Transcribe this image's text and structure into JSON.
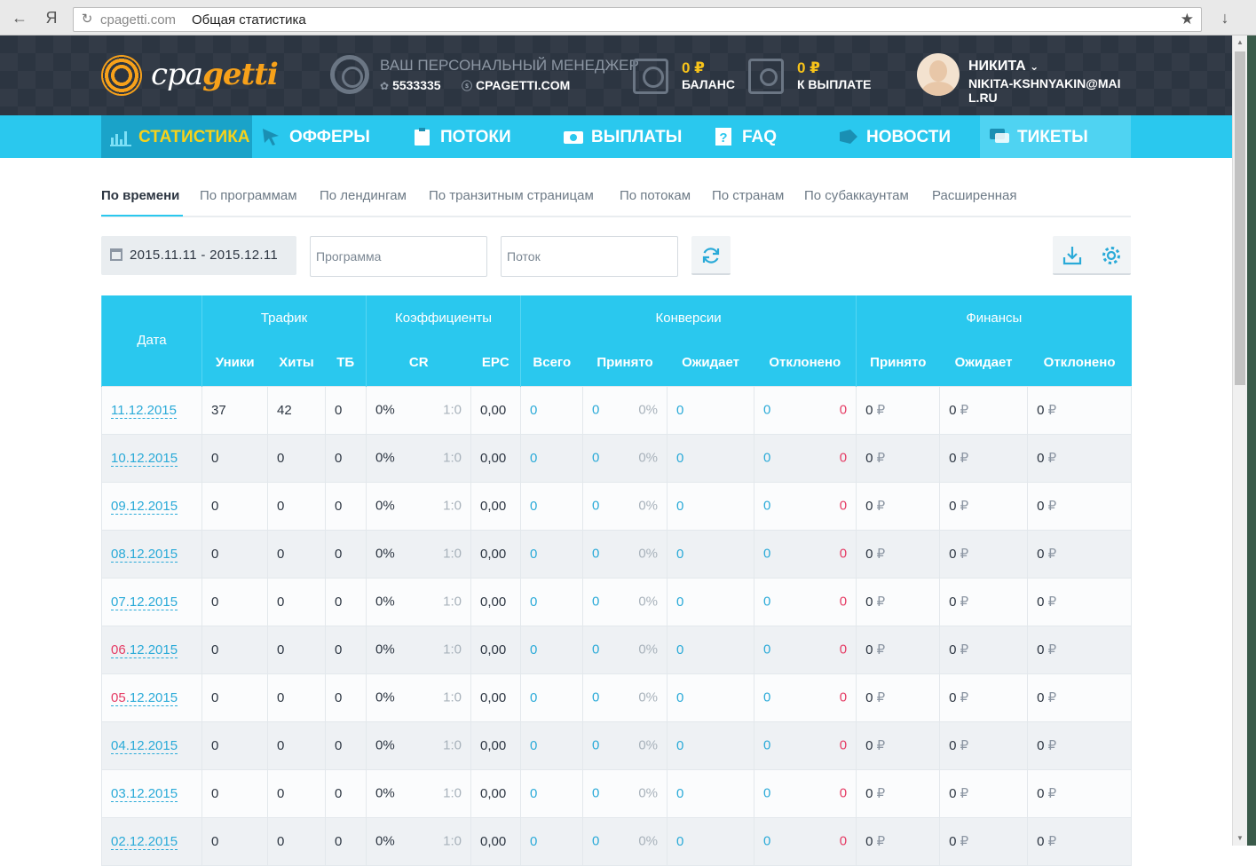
{
  "browser": {
    "host": "cpagetti.com",
    "page_title": "Общая статистика",
    "back_glyph": "←",
    "yandex_glyph": "Я",
    "reload_glyph": "↻",
    "star_glyph": "★",
    "download_glyph": "↓"
  },
  "header": {
    "logo_prefix": "cpa",
    "logo_suffix": "getti",
    "manager_title": "ВАШ ПЕРСОНАЛЬНЫЙ МЕНЕДЖЕР",
    "manager_icq": "5533335",
    "manager_skype": "CPAGETTI.COM",
    "balance_value": "0 ₽",
    "balance_label": "БАЛАНС",
    "payout_value": "0 ₽",
    "payout_label": "К ВЫПЛАТЕ",
    "user_name": "НИКИТА",
    "user_email": "NIKITA-KSHNYAKIN@MAIL.RU"
  },
  "nav": [
    {
      "label": "СТАТИСТИКА",
      "icon": "bar-chart-icon"
    },
    {
      "label": "ОФФЕРЫ",
      "icon": "cursor-icon"
    },
    {
      "label": "ПОТОКИ",
      "icon": "clipboard-icon"
    },
    {
      "label": "ВЫПЛАТЫ",
      "icon": "money-icon"
    },
    {
      "label": "FAQ",
      "icon": "question-icon"
    },
    {
      "label": "НОВОСТИ",
      "icon": "megaphone-icon"
    },
    {
      "label": "ТИКЕТЫ",
      "icon": "chat-icon"
    }
  ],
  "subtabs": [
    "По времени",
    "По программам",
    "По лендингам",
    "По транзитным страницам",
    "По потокам",
    "По странам",
    "По субаккаунтам",
    "Расширенная"
  ],
  "filters": {
    "date_range": "2015.11.11 - 2015.12.11",
    "program_placeholder": "Программа",
    "stream_placeholder": "Поток"
  },
  "table": {
    "date_header": "Дата",
    "groups": [
      "Трафик",
      "Коэффициенты",
      "Конверсии",
      "Финансы"
    ],
    "columns": [
      "Уники",
      "Хиты",
      "ТБ",
      "CR",
      "EPC",
      "Всего",
      "Принято",
      "Ожидает",
      "Отклонено",
      "Принято",
      "Ожидает",
      "Отклонено"
    ],
    "currency": "₽",
    "rows": [
      {
        "day": "11",
        "rest": ".12.2015",
        "weekend": false,
        "uniq": "37",
        "hits": "42",
        "tb": "0",
        "cr": "0%",
        "ratio": "1:0",
        "epc": "0,00",
        "total": "0",
        "accepted": "0",
        "accepted_pct": "0%",
        "pending": "0",
        "rejected": "0",
        "rejected_n": "0",
        "fin_accepted": "0",
        "fin_pending": "0",
        "fin_rejected": "0"
      },
      {
        "day": "10",
        "rest": ".12.2015",
        "weekend": false,
        "uniq": "0",
        "hits": "0",
        "tb": "0",
        "cr": "0%",
        "ratio": "1:0",
        "epc": "0,00",
        "total": "0",
        "accepted": "0",
        "accepted_pct": "0%",
        "pending": "0",
        "rejected": "0",
        "rejected_n": "0",
        "fin_accepted": "0",
        "fin_pending": "0",
        "fin_rejected": "0"
      },
      {
        "day": "09",
        "rest": ".12.2015",
        "weekend": false,
        "uniq": "0",
        "hits": "0",
        "tb": "0",
        "cr": "0%",
        "ratio": "1:0",
        "epc": "0,00",
        "total": "0",
        "accepted": "0",
        "accepted_pct": "0%",
        "pending": "0",
        "rejected": "0",
        "rejected_n": "0",
        "fin_accepted": "0",
        "fin_pending": "0",
        "fin_rejected": "0"
      },
      {
        "day": "08",
        "rest": ".12.2015",
        "weekend": false,
        "uniq": "0",
        "hits": "0",
        "tb": "0",
        "cr": "0%",
        "ratio": "1:0",
        "epc": "0,00",
        "total": "0",
        "accepted": "0",
        "accepted_pct": "0%",
        "pending": "0",
        "rejected": "0",
        "rejected_n": "0",
        "fin_accepted": "0",
        "fin_pending": "0",
        "fin_rejected": "0"
      },
      {
        "day": "07",
        "rest": ".12.2015",
        "weekend": false,
        "uniq": "0",
        "hits": "0",
        "tb": "0",
        "cr": "0%",
        "ratio": "1:0",
        "epc": "0,00",
        "total": "0",
        "accepted": "0",
        "accepted_pct": "0%",
        "pending": "0",
        "rejected": "0",
        "rejected_n": "0",
        "fin_accepted": "0",
        "fin_pending": "0",
        "fin_rejected": "0"
      },
      {
        "day": "06",
        "rest": ".12.2015",
        "weekend": true,
        "uniq": "0",
        "hits": "0",
        "tb": "0",
        "cr": "0%",
        "ratio": "1:0",
        "epc": "0,00",
        "total": "0",
        "accepted": "0",
        "accepted_pct": "0%",
        "pending": "0",
        "rejected": "0",
        "rejected_n": "0",
        "fin_accepted": "0",
        "fin_pending": "0",
        "fin_rejected": "0"
      },
      {
        "day": "05",
        "rest": ".12.2015",
        "weekend": true,
        "uniq": "0",
        "hits": "0",
        "tb": "0",
        "cr": "0%",
        "ratio": "1:0",
        "epc": "0,00",
        "total": "0",
        "accepted": "0",
        "accepted_pct": "0%",
        "pending": "0",
        "rejected": "0",
        "rejected_n": "0",
        "fin_accepted": "0",
        "fin_pending": "0",
        "fin_rejected": "0"
      },
      {
        "day": "04",
        "rest": ".12.2015",
        "weekend": false,
        "uniq": "0",
        "hits": "0",
        "tb": "0",
        "cr": "0%",
        "ratio": "1:0",
        "epc": "0,00",
        "total": "0",
        "accepted": "0",
        "accepted_pct": "0%",
        "pending": "0",
        "rejected": "0",
        "rejected_n": "0",
        "fin_accepted": "0",
        "fin_pending": "0",
        "fin_rejected": "0"
      },
      {
        "day": "03",
        "rest": ".12.2015",
        "weekend": false,
        "uniq": "0",
        "hits": "0",
        "tb": "0",
        "cr": "0%",
        "ratio": "1:0",
        "epc": "0,00",
        "total": "0",
        "accepted": "0",
        "accepted_pct": "0%",
        "pending": "0",
        "rejected": "0",
        "rejected_n": "0",
        "fin_accepted": "0",
        "fin_pending": "0",
        "fin_rejected": "0"
      },
      {
        "day": "02",
        "rest": ".12.2015",
        "weekend": false,
        "uniq": "0",
        "hits": "0",
        "tb": "0",
        "cr": "0%",
        "ratio": "1:0",
        "epc": "0,00",
        "total": "0",
        "accepted": "0",
        "accepted_pct": "0%",
        "pending": "0",
        "rejected": "0",
        "rejected_n": "0",
        "fin_accepted": "0",
        "fin_pending": "0",
        "fin_rejected": "0"
      }
    ]
  },
  "colors": {
    "accent": "#2ac8ee",
    "header_bg": "#2c3541",
    "active_nav": "#1aa3c9",
    "active_label": "#f7d21a",
    "link": "#2aaad8",
    "negative": "#e53a63"
  }
}
